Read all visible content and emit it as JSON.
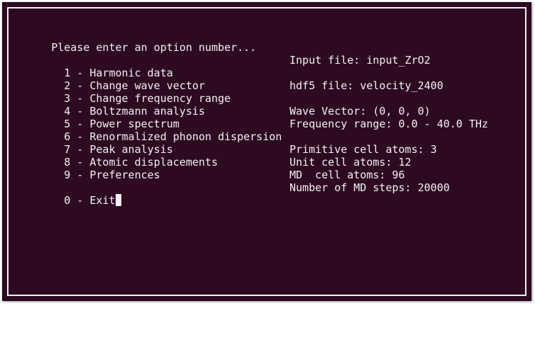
{
  "terminal": {
    "prompt": "Please enter an option number...",
    "menu": [
      {
        "key": "1",
        "label": "Harmonic data"
      },
      {
        "key": "2",
        "label": "Change wave vector"
      },
      {
        "key": "3",
        "label": "Change frequency range"
      },
      {
        "key": "4",
        "label": "Boltzmann analysis"
      },
      {
        "key": "5",
        "label": "Power spectrum"
      },
      {
        "key": "6",
        "label": "Renormalized phonon dispersion"
      },
      {
        "key": "7",
        "label": "Peak analysis"
      },
      {
        "key": "8",
        "label": "Atomic displacements"
      },
      {
        "key": "9",
        "label": "Preferences"
      }
    ],
    "exit": {
      "key": "0",
      "label": "Exit"
    },
    "info": {
      "input_file": "Input file: input_ZrO2",
      "hdf5_file": "hdf5 file: velocity_2400",
      "wave_vector": "Wave Vector: (0, 0, 0)",
      "frequency_range": "Frequency range: 0.0 - 40.0 THz",
      "primitive_atoms": "Primitive cell atoms: 3",
      "unit_atoms": "Unit cell atoms: 12",
      "md_atoms": "MD  cell atoms: 96",
      "md_steps": "Number of MD steps: 20000"
    },
    "colors": {
      "background": "#2d0922",
      "foreground": "#f2f2f2"
    }
  }
}
